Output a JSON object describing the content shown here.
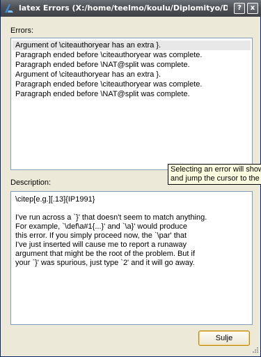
{
  "window": {
    "title": "latex Errors (X:/home/teelmo/koulu/Diplomityo/Di...",
    "help_label": "?",
    "close_label": "x"
  },
  "errors": {
    "label": "Errors:",
    "items": [
      {
        "text": "Argument of \\citeauthoryear has an extra }."
      },
      {
        "text": "Paragraph ended before \\citeauthoryear was complete."
      },
      {
        "text": "Paragraph ended before \\NAT@split was complete."
      },
      {
        "text": "Argument of \\citeauthoryear has an extra }."
      },
      {
        "text": "Paragraph ended before \\citeauthoryear was complete."
      },
      {
        "text": "Paragraph ended before \\NAT@split was complete."
      }
    ]
  },
  "description": {
    "label": "Description:",
    "text": "\\citep[e.g.][.13]{IP1991}\n\nI've run across a `}' that doesn't seem to match anything.\nFor example, `\\def\\a#1{...}' and `\\a}' would produce\nthis error. If you simply proceed now, the `\\par' that\nI've just inserted will cause me to report a runaway\nargument that might be the root of the problem. But if\nyour `}' was spurious, just type `2' and it will go away."
  },
  "tooltip": {
    "line1": "Selecting an error will show",
    "line2": "and jump the cursor to the l"
  },
  "buttons": {
    "close_label": "Sulje"
  }
}
